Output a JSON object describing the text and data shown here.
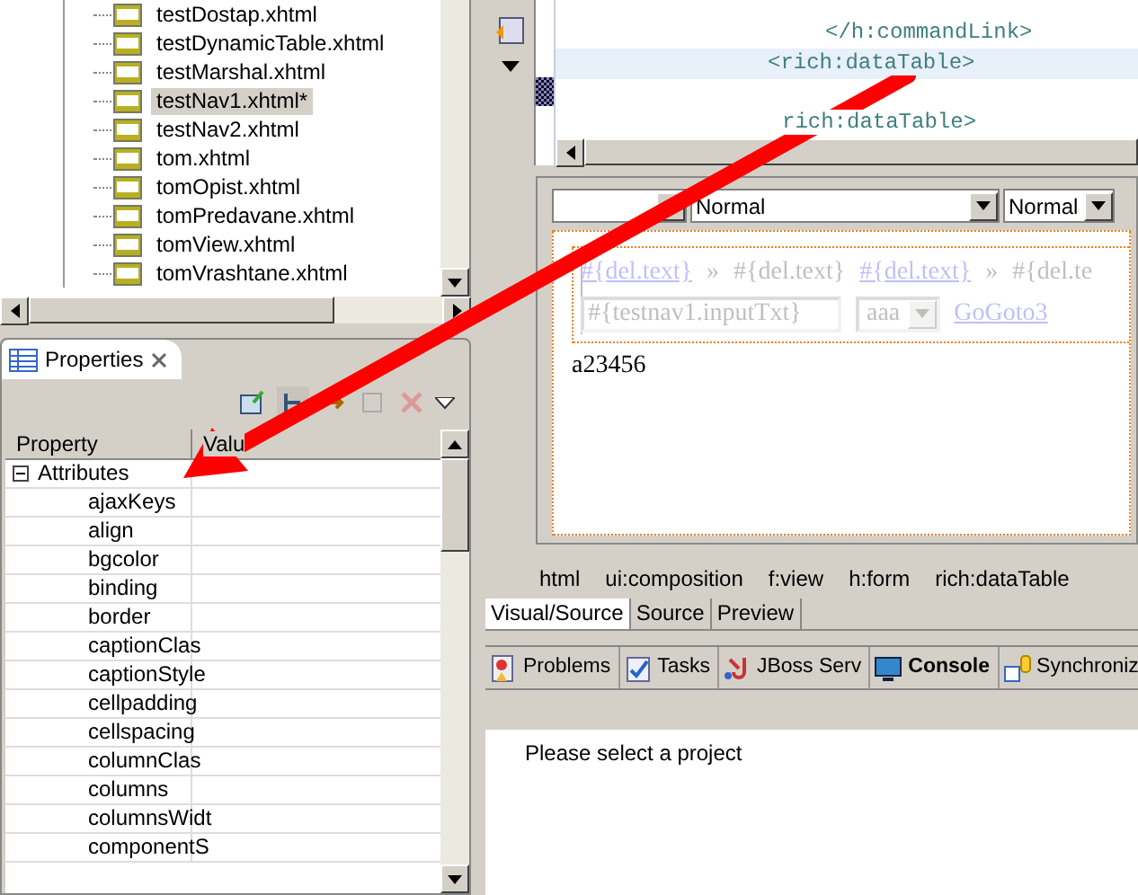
{
  "file_tree": {
    "items": [
      {
        "label": "testDostap.xhtml",
        "selected": false
      },
      {
        "label": "testDynamicTable.xhtml",
        "selected": false
      },
      {
        "label": "testMarshal.xhtml",
        "selected": false
      },
      {
        "label": "testNav1.xhtml*",
        "selected": true
      },
      {
        "label": "testNav2.xhtml",
        "selected": false
      },
      {
        "label": "tom.xhtml",
        "selected": false
      },
      {
        "label": "tomOpist.xhtml",
        "selected": false
      },
      {
        "label": "tomPredavane.xhtml",
        "selected": false
      },
      {
        "label": "tomView.xhtml",
        "selected": false
      },
      {
        "label": "tomVrashtane.xhtml",
        "selected": false
      }
    ]
  },
  "properties_view": {
    "title": "Properties",
    "columns": [
      "Property",
      "Valu"
    ],
    "groups": [
      {
        "label": "Attributes",
        "expanded": true,
        "children": [
          {
            "label": "ajaxKeys"
          },
          {
            "label": "align"
          },
          {
            "label": "bgcolor"
          },
          {
            "label": "binding"
          },
          {
            "label": "border"
          },
          {
            "label": "captionClas"
          },
          {
            "label": "captionStyle"
          },
          {
            "label": "cellpadding"
          },
          {
            "label": "cellspacing"
          },
          {
            "label": "columnClas"
          },
          {
            "label": "columns"
          },
          {
            "label": "columnsWidt"
          },
          {
            "label": "componentS"
          }
        ]
      }
    ]
  },
  "source_editor": {
    "lines": [
      {
        "text": "</h:commandLink>",
        "current": false
      },
      {
        "text": "<rich:dataTable>",
        "current": true
      },
      {
        "text": "rich:dataTable>",
        "current": false
      }
    ]
  },
  "visual_editor": {
    "toolbar": [
      {
        "kind": "blank"
      },
      {
        "kind": "combo",
        "value": "Normal"
      },
      {
        "kind": "combo",
        "value": "Normal"
      }
    ],
    "lines": [
      {
        "items": [
          {
            "kind": "link",
            "text": "#{del.text}"
          },
          {
            "kind": "text",
            "text": "»"
          },
          {
            "kind": "text",
            "text": "#{del.text}"
          },
          {
            "kind": "link",
            "text": "#{del.text}"
          },
          {
            "kind": "text",
            "text": "»"
          },
          {
            "kind": "text",
            "text": "#{del.te"
          }
        ]
      },
      {
        "items": [
          {
            "kind": "input",
            "text": "#{testnav1.inputTxt}"
          },
          {
            "kind": "select",
            "text": "aaa"
          },
          {
            "kind": "link",
            "text": "GoGoto3"
          }
        ]
      }
    ],
    "output": "a23456"
  },
  "breadcrumb": [
    "html",
    "ui:composition",
    "f:view",
    "h:form",
    "rich:dataTable"
  ],
  "editor_tabs": [
    {
      "label": "Visual/Source",
      "selected": true
    },
    {
      "label": "Source",
      "selected": false
    },
    {
      "label": "Preview",
      "selected": false
    }
  ],
  "bottom_tabs": [
    {
      "label": "Problems",
      "kind": "problems",
      "selected": false
    },
    {
      "label": "Tasks",
      "kind": "tasks",
      "selected": false
    },
    {
      "label": "JBoss Serv",
      "kind": "server",
      "selected": false
    },
    {
      "label": "Console",
      "kind": "console",
      "selected": true
    },
    {
      "label": "Synchroniz",
      "kind": "sync",
      "selected": false
    }
  ],
  "console": {
    "message": "Please select a project"
  }
}
